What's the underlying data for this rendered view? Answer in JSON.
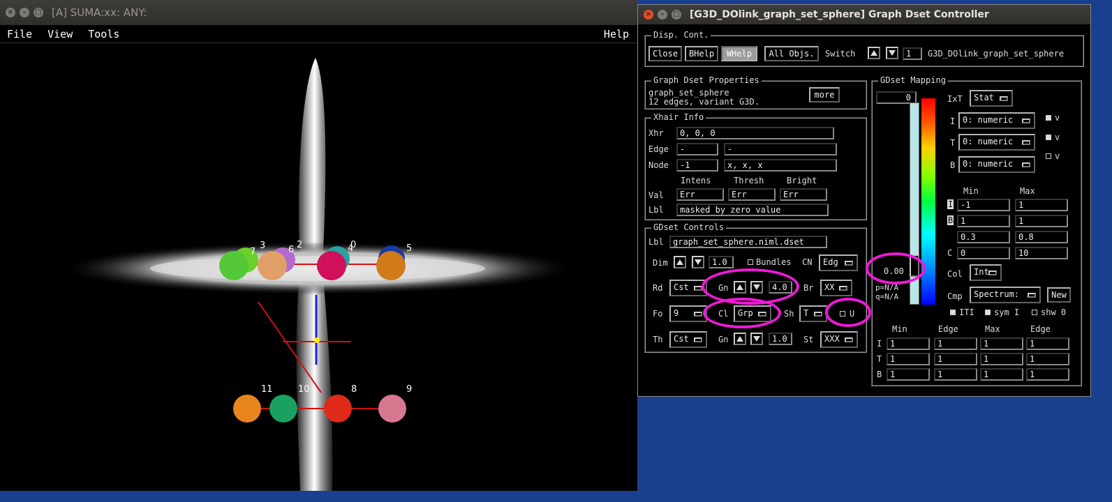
{
  "suma_window": {
    "title": "[A] SUMA:xx: ANY:",
    "menu": {
      "file": "File",
      "view": "View",
      "tools": "Tools",
      "help": "Help"
    }
  },
  "viewer": {
    "node_labels": [
      "7",
      "3",
      "6",
      "2",
      "0",
      "4",
      "5",
      "11",
      "10",
      "8",
      "9"
    ]
  },
  "controller": {
    "title": "[G3D_DOlink_graph_set_sphere] Graph Dset Controller",
    "disp_cont": {
      "title": "Disp. Cont.",
      "close": "Close",
      "bhelp": "BHelp",
      "whelp": "WHelp",
      "all_objs": "All Objs.",
      "switch": "Switch",
      "switch_value": "1",
      "dset_name": "G3D_DOlink_graph_set_sphere"
    },
    "properties": {
      "title": "Graph Dset Properties",
      "line1": "graph_set_sphere",
      "line2": "12 edges, variant G3D.",
      "more": "more"
    },
    "xhair": {
      "title": "Xhair Info",
      "xhr_label": "Xhr",
      "xhr_value": "0, 0, 0",
      "edge_label": "Edge",
      "edge_value": "-",
      "edge_info": "-",
      "node_label": "Node",
      "node_value": "-1",
      "node_info": "x, x, x",
      "col_intens": "Intens",
      "col_thresh": "Thresh",
      "col_bright": "Bright",
      "val_label": "Val",
      "val_i": "Err",
      "val_t": "Err",
      "val_b": "Err",
      "lbl_label": "Lbl",
      "lbl_value": "masked by zero value"
    },
    "controls": {
      "title": "GDset Controls",
      "lbl_label": "Lbl",
      "lbl_value": "graph_set_sphere.niml.dset",
      "dim_label": "Dim",
      "dim_value": "1.0",
      "bundles": "Bundles",
      "cn_label": "CN",
      "cn_value": "Edg",
      "rd_label": "Rd",
      "rd_value": "Cst",
      "gn_label": "Gn",
      "gn_value": "4.0",
      "br_label": "Br",
      "br_value": "XX",
      "fo_label": "Fo",
      "fo_value": "9",
      "cl_label": "Cl",
      "cl_value": "Grp",
      "sh_label": "Sh",
      "sh_value": "T",
      "u_label": "U",
      "th_label": "Th",
      "th_value": "Cst",
      "gn2_label": "Gn",
      "gn2_value": "1.0",
      "st_label": "St",
      "st_value": "XXX"
    },
    "mapping": {
      "title": "GDset Mapping",
      "top_value": "0",
      "bar_value": "0.00",
      "p_text": "p=N/A",
      "q_text": "q=N/A",
      "ixt_label": "IxT",
      "ixt_value": "Stat",
      "i_label": "I",
      "i_value": "0: numeric",
      "t_label": "T",
      "t_value": "0: numeric",
      "b_label": "B",
      "b_value": "0: numeric",
      "v": "v",
      "min_hdr": "Min",
      "max_hdr": "Max",
      "row_i_min": "-1",
      "row_i_max": "1",
      "row_b_min": "1",
      "row_b_max": "1",
      "row_3_min": "0.3",
      "row_3_max": "0.8",
      "c_label": "C",
      "row_c_min": "0",
      "row_c_max": "10",
      "col_label": "Col",
      "col_value": "Int",
      "cmp_label": "Cmp",
      "cmp_value": "Spectrum:",
      "new_button": "New",
      "iti": "ITI",
      "sym_i": "sym I",
      "shw_0": "shw 0",
      "table_headers": [
        "Min",
        "Edge",
        "Max",
        "Edge"
      ],
      "table_rows": [
        {
          "label": "I",
          "cells": [
            "1",
            "1",
            "1",
            "1"
          ]
        },
        {
          "label": "T",
          "cells": [
            "1",
            "1",
            "1",
            "1"
          ]
        },
        {
          "label": "B",
          "cells": [
            "1",
            "1",
            "1",
            "1"
          ]
        }
      ]
    }
  }
}
